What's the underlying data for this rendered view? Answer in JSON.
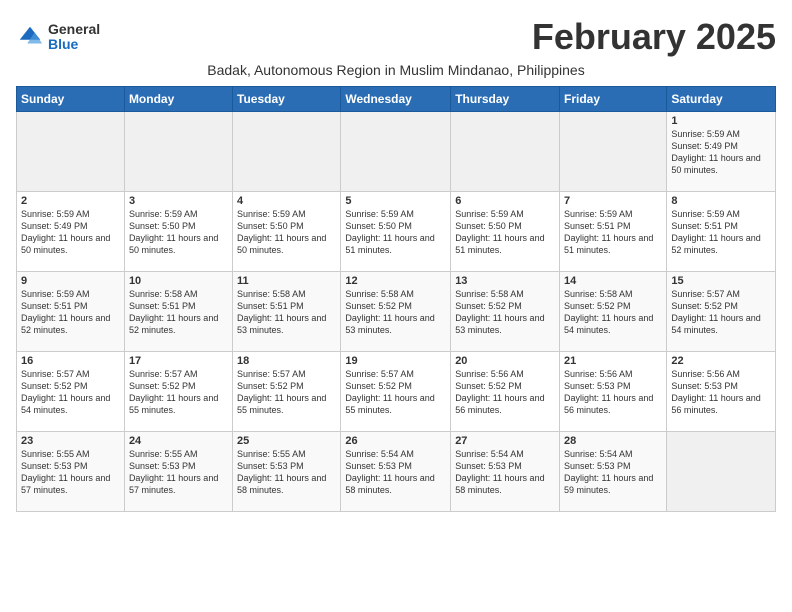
{
  "logo": {
    "general": "General",
    "blue": "Blue"
  },
  "month_title": "February 2025",
  "subtitle": "Badak, Autonomous Region in Muslim Mindanao, Philippines",
  "days_of_week": [
    "Sunday",
    "Monday",
    "Tuesday",
    "Wednesday",
    "Thursday",
    "Friday",
    "Saturday"
  ],
  "weeks": [
    [
      {
        "day": "",
        "info": ""
      },
      {
        "day": "",
        "info": ""
      },
      {
        "day": "",
        "info": ""
      },
      {
        "day": "",
        "info": ""
      },
      {
        "day": "",
        "info": ""
      },
      {
        "day": "",
        "info": ""
      },
      {
        "day": "1",
        "info": "Sunrise: 5:59 AM\nSunset: 5:49 PM\nDaylight: 11 hours and 50 minutes."
      }
    ],
    [
      {
        "day": "2",
        "info": "Sunrise: 5:59 AM\nSunset: 5:49 PM\nDaylight: 11 hours and 50 minutes."
      },
      {
        "day": "3",
        "info": "Sunrise: 5:59 AM\nSunset: 5:50 PM\nDaylight: 11 hours and 50 minutes."
      },
      {
        "day": "4",
        "info": "Sunrise: 5:59 AM\nSunset: 5:50 PM\nDaylight: 11 hours and 50 minutes."
      },
      {
        "day": "5",
        "info": "Sunrise: 5:59 AM\nSunset: 5:50 PM\nDaylight: 11 hours and 51 minutes."
      },
      {
        "day": "6",
        "info": "Sunrise: 5:59 AM\nSunset: 5:50 PM\nDaylight: 11 hours and 51 minutes."
      },
      {
        "day": "7",
        "info": "Sunrise: 5:59 AM\nSunset: 5:51 PM\nDaylight: 11 hours and 51 minutes."
      },
      {
        "day": "8",
        "info": "Sunrise: 5:59 AM\nSunset: 5:51 PM\nDaylight: 11 hours and 52 minutes."
      }
    ],
    [
      {
        "day": "9",
        "info": "Sunrise: 5:59 AM\nSunset: 5:51 PM\nDaylight: 11 hours and 52 minutes."
      },
      {
        "day": "10",
        "info": "Sunrise: 5:58 AM\nSunset: 5:51 PM\nDaylight: 11 hours and 52 minutes."
      },
      {
        "day": "11",
        "info": "Sunrise: 5:58 AM\nSunset: 5:51 PM\nDaylight: 11 hours and 53 minutes."
      },
      {
        "day": "12",
        "info": "Sunrise: 5:58 AM\nSunset: 5:52 PM\nDaylight: 11 hours and 53 minutes."
      },
      {
        "day": "13",
        "info": "Sunrise: 5:58 AM\nSunset: 5:52 PM\nDaylight: 11 hours and 53 minutes."
      },
      {
        "day": "14",
        "info": "Sunrise: 5:58 AM\nSunset: 5:52 PM\nDaylight: 11 hours and 54 minutes."
      },
      {
        "day": "15",
        "info": "Sunrise: 5:57 AM\nSunset: 5:52 PM\nDaylight: 11 hours and 54 minutes."
      }
    ],
    [
      {
        "day": "16",
        "info": "Sunrise: 5:57 AM\nSunset: 5:52 PM\nDaylight: 11 hours and 54 minutes."
      },
      {
        "day": "17",
        "info": "Sunrise: 5:57 AM\nSunset: 5:52 PM\nDaylight: 11 hours and 55 minutes."
      },
      {
        "day": "18",
        "info": "Sunrise: 5:57 AM\nSunset: 5:52 PM\nDaylight: 11 hours and 55 minutes."
      },
      {
        "day": "19",
        "info": "Sunrise: 5:57 AM\nSunset: 5:52 PM\nDaylight: 11 hours and 55 minutes."
      },
      {
        "day": "20",
        "info": "Sunrise: 5:56 AM\nSunset: 5:52 PM\nDaylight: 11 hours and 56 minutes."
      },
      {
        "day": "21",
        "info": "Sunrise: 5:56 AM\nSunset: 5:53 PM\nDaylight: 11 hours and 56 minutes."
      },
      {
        "day": "22",
        "info": "Sunrise: 5:56 AM\nSunset: 5:53 PM\nDaylight: 11 hours and 56 minutes."
      }
    ],
    [
      {
        "day": "23",
        "info": "Sunrise: 5:55 AM\nSunset: 5:53 PM\nDaylight: 11 hours and 57 minutes."
      },
      {
        "day": "24",
        "info": "Sunrise: 5:55 AM\nSunset: 5:53 PM\nDaylight: 11 hours and 57 minutes."
      },
      {
        "day": "25",
        "info": "Sunrise: 5:55 AM\nSunset: 5:53 PM\nDaylight: 11 hours and 58 minutes."
      },
      {
        "day": "26",
        "info": "Sunrise: 5:54 AM\nSunset: 5:53 PM\nDaylight: 11 hours and 58 minutes."
      },
      {
        "day": "27",
        "info": "Sunrise: 5:54 AM\nSunset: 5:53 PM\nDaylight: 11 hours and 58 minutes."
      },
      {
        "day": "28",
        "info": "Sunrise: 5:54 AM\nSunset: 5:53 PM\nDaylight: 11 hours and 59 minutes."
      },
      {
        "day": "",
        "info": ""
      }
    ]
  ]
}
